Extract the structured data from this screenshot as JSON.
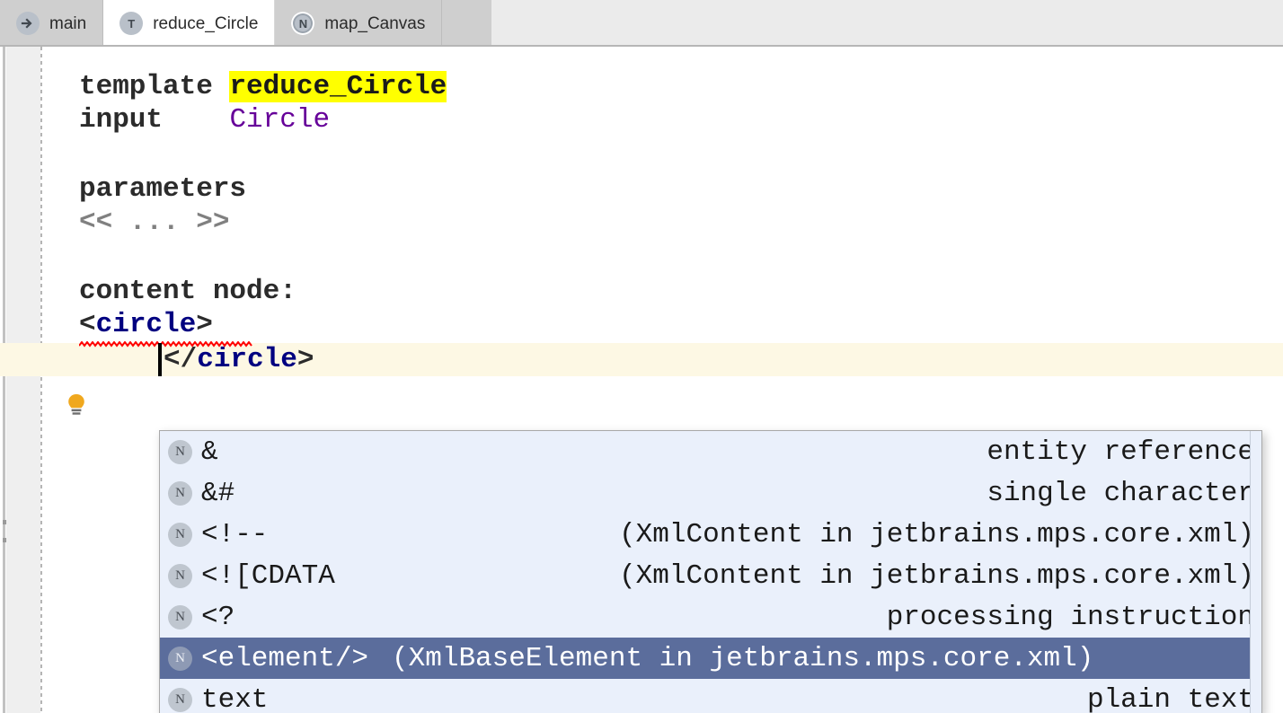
{
  "window": {
    "colors": {
      "tab_bar_bg": "#cfcfcf",
      "tab_active_bg": "#ffffff",
      "editor_bg": "#ffffff",
      "gutter_bg": "#efefef",
      "caret_line_bg": "#fdf8e4",
      "popup_bg": "#eaf0fb",
      "popup_selected_bg": "#5b6d9c",
      "keyword_fg": "#2b2b2b",
      "type_fg": "#660099",
      "tag_fg": "#000080",
      "placeholder_fg": "#808080",
      "search_highlight_bg": "#ffff00",
      "error_squiggle": "#ff0000",
      "bulb_fg": "#f0a81e"
    }
  },
  "tabs": [
    {
      "label": "main",
      "icon": "arrow-right-circle-icon",
      "icon_letter": "",
      "active": false
    },
    {
      "label": "reduce_Circle",
      "icon": "template-node-icon",
      "icon_letter": "T",
      "active": true
    },
    {
      "label": "map_Canvas",
      "icon": "node-ring-icon",
      "icon_letter": "N",
      "active": false
    }
  ],
  "editor": {
    "gutter": {
      "intention_bulb": "lightbulb-icon"
    },
    "lines": [
      {
        "id": "line-template",
        "segments": [
          {
            "text": "template ",
            "style": "kw"
          },
          {
            "text": "reduce_Circle",
            "style": "hl"
          }
        ]
      },
      {
        "id": "line-input",
        "segments": [
          {
            "text": "input    ",
            "style": "kw"
          },
          {
            "text": "Circle",
            "style": "type"
          }
        ]
      },
      {
        "id": "line-parameters",
        "segments": [
          {
            "text": "parameters",
            "style": "kw"
          }
        ]
      },
      {
        "id": "line-parameters-placeholder",
        "segments": [
          {
            "text": "<< ... >>",
            "style": "grey"
          }
        ]
      },
      {
        "id": "line-content-node",
        "segments": [
          {
            "text": "content node:",
            "style": "kw"
          }
        ]
      },
      {
        "id": "line-open-tag",
        "segments": [
          {
            "text": "<",
            "style": "angle"
          },
          {
            "text": "circle",
            "style": "tagname"
          },
          {
            "text": ">",
            "style": "angle"
          }
        ]
      },
      {
        "id": "line-close-tag",
        "segments": [
          {
            "text": "</",
            "style": "angle"
          },
          {
            "text": "circle",
            "style": "tagname"
          },
          {
            "text": ">",
            "style": "angle"
          }
        ]
      }
    ],
    "text_plain": {
      "template": "template reduce_Circle",
      "input": "input    Circle",
      "parameters": "parameters",
      "parameters_placeholder": "<< ... >>",
      "content_node": "content node:",
      "open_tag": "<circle>",
      "close_tag": "</circle>"
    }
  },
  "completion_popup": {
    "items": [
      {
        "badge": "N",
        "label": "&",
        "description": "entity reference",
        "selected": false
      },
      {
        "badge": "N",
        "label": "&#",
        "description": "single character",
        "selected": false
      },
      {
        "badge": "N",
        "label": "<!--",
        "description": "(XmlContent in jetbrains.mps.core.xml)",
        "selected": false
      },
      {
        "badge": "N",
        "label": "<![CDATA",
        "description": "(XmlContent in jetbrains.mps.core.xml)",
        "selected": false
      },
      {
        "badge": "N",
        "label": "<?",
        "description": "processing instruction",
        "selected": false
      },
      {
        "badge": "N",
        "label": "<element/>",
        "description": "(XmlBaseElement in jetbrains.mps.core.xml)",
        "selected": true
      },
      {
        "badge": "N",
        "label": "text",
        "description": "plain text",
        "selected": false
      }
    ]
  }
}
